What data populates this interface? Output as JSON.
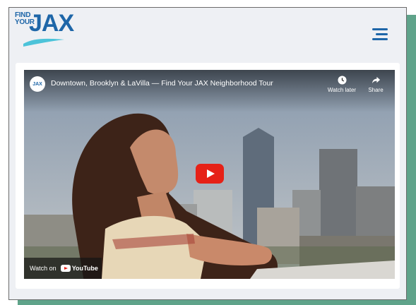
{
  "logo": {
    "line1": "FIND",
    "line2": "YOUR",
    "brand": "JAX"
  },
  "header": {
    "menu_icon": "hamburger-menu-icon"
  },
  "video": {
    "channel_avatar_text": "JAX",
    "title": "Downtown, Brooklyn & LaVilla — Find Your JAX Neighborhood Tour",
    "watch_later_label": "Watch later",
    "share_label": "Share",
    "watch_on_label": "Watch on",
    "youtube_label": "YouTube"
  },
  "colors": {
    "brand_blue": "#1e66a8",
    "wave_teal": "#4cc3d9",
    "accent_green": "#5fa38a",
    "play_red": "#e62117"
  }
}
